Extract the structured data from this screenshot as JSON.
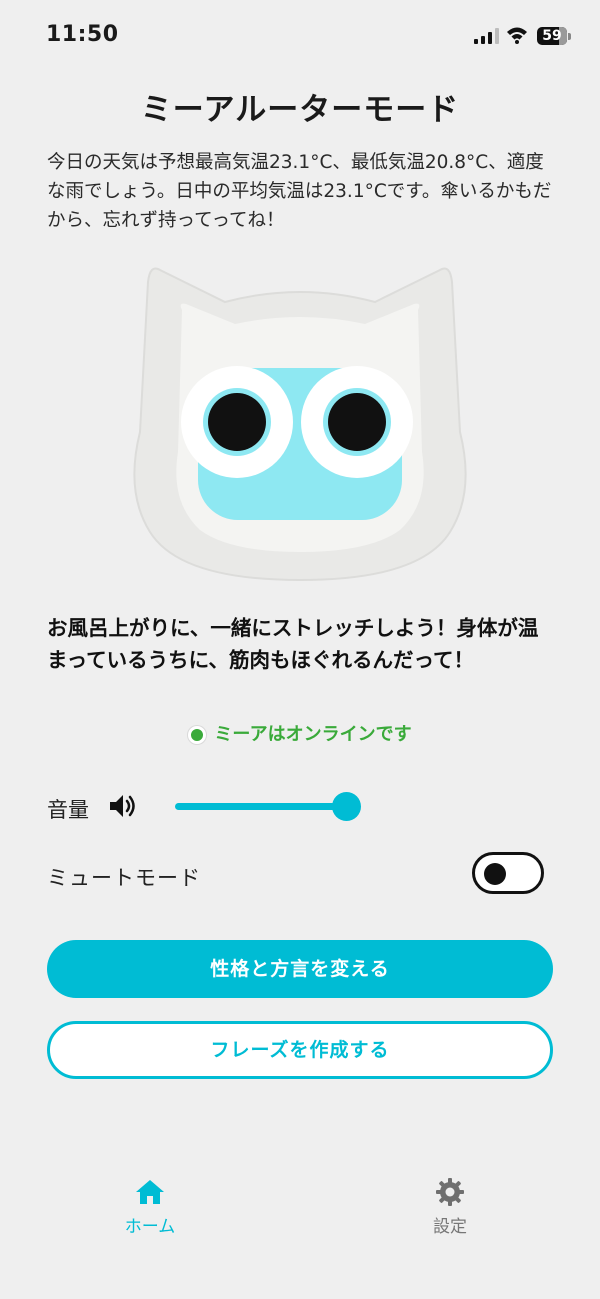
{
  "status_bar": {
    "time": "11:50",
    "battery": "59"
  },
  "title": "ミーアルーターモード",
  "weather_text": "今日の天気は予想最高気温23.1°C、最低気温20.8°C、適度な雨でしょう。日中の平均気温は23.1°Cです。傘いるかもだから、忘れず持ってってね！",
  "character": {
    "icon": "cat-robot-face",
    "face_color": "#8ee8f2",
    "head_color": "#e8e8e6"
  },
  "message_text": "お風呂上がりに、一緒にストレッチしよう！身体が温まっているうちに、筋肉もほぐれるんだって！",
  "online_status": "ミーアはオンラインです",
  "volume": {
    "label": "音量",
    "icon": "speaker-icon",
    "level": 0.95
  },
  "mute": {
    "label": "ミュートモード",
    "enabled": false
  },
  "buttons": {
    "change_personality": "性格と方言を変える",
    "create_phrase": "フレーズを作成する"
  },
  "bottom_nav": {
    "home_label": "ホーム",
    "settings_label": "設定"
  },
  "colors": {
    "accent": "#00bcd4",
    "online": "#3aaa3a",
    "background": "#efefef"
  }
}
